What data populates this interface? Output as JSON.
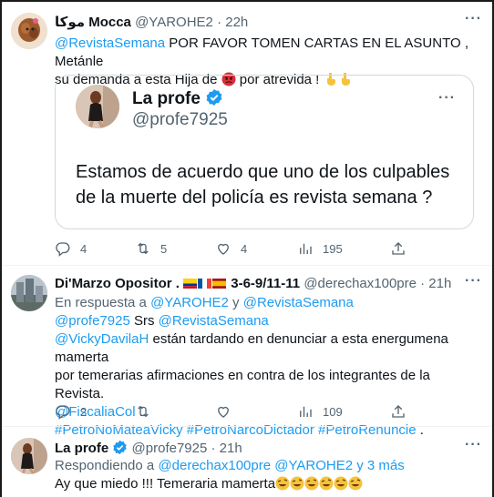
{
  "tweet1": {
    "name": "موكا Mocca",
    "handle": "@YAROHE2",
    "time": "· 22h",
    "text_mention": "@RevistaSemana",
    "text_line1": "  POR FAVOR TOMEN CARTAS EN EL ASUNTO , Metánle",
    "text_line2a": "su demanda a esta Hija de ",
    "text_line2b": " por atrevida ! ",
    "quote": {
      "name": "La profe",
      "handle": "@profe7925",
      "text_line1": "Estamos de acuerdo que uno de los culpables",
      "text_line2": "de la muerte del policía es revista semana ?"
    },
    "replies": "4",
    "retweets": "5",
    "likes": "4",
    "views": "195"
  },
  "tweet2": {
    "name": "Di'Marzo Opositor .",
    "name_suffix": "3-6-9/11-11",
    "handle": "@derechax100pre",
    "time": "· 21h",
    "reply_prefix": "En respuesta a ",
    "reply_user1": "@YAROHE2",
    "reply_and": " y ",
    "reply_user2": "@RevistaSemana",
    "line1_mention": "@profe7925",
    "line1_text": " Srs ",
    "line1_mention2": "@RevistaSemana",
    "line2_mention": "@VickyDavilaH",
    "line2_text": " están tardando en denunciar a esta energumena mamerta",
    "line3_text": "por temerarias afirmaciones en contra de los integrantes de la Revista.",
    "line4_mention": "@FiscaliaCol",
    "line4_text": " .",
    "line5_tags": "#PetroNoMateaVicky #PetroNarcoDictador #PetroRenuncie",
    "line5_text": " .",
    "replies": "2",
    "retweets": "",
    "likes": "",
    "views": "109"
  },
  "tweet3": {
    "name": "La profe",
    "handle": "@profe7925",
    "time": "· 21h",
    "reply_prefix": "Respondiendo a ",
    "reply_users": "@derechax100pre @YAROHE2 y 3 más",
    "text": "Ay que miedo !!! Temeraria mamerta"
  },
  "colors": {
    "link": "#1d9bf0",
    "muted": "#536471",
    "text": "#0f1419",
    "border": "#cfd9de"
  }
}
